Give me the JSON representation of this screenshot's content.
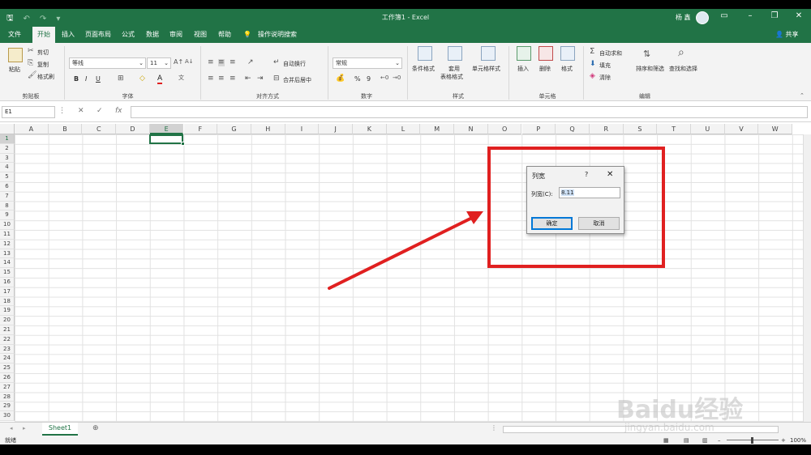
{
  "app": {
    "window_title": "工作簿1 - Excel",
    "user_name": "杨 鑫",
    "share_label": "共享"
  },
  "menu_tabs": [
    "文件",
    "开始",
    "插入",
    "页面布局",
    "公式",
    "数据",
    "审阅",
    "视图",
    "帮助"
  ],
  "active_tab": "开始",
  "tell_me": "操作说明搜索",
  "ribbon": {
    "clipboard": {
      "paste": "粘贴",
      "cut": "剪切",
      "copy": "复制",
      "format_painter": "格式刷",
      "group": "剪贴板"
    },
    "font": {
      "font_name": "等线",
      "font_size": "11",
      "bold": "B",
      "italic": "I",
      "underline": "U",
      "font_color": "A",
      "group": "字体"
    },
    "alignment": {
      "wrap_text": "自动换行",
      "merge_center": "合并后居中",
      "group": "对齐方式"
    },
    "number": {
      "format": "常规",
      "percent": "%",
      "comma": "9",
      "group": "数字"
    },
    "styles": {
      "conditional": "条件格式",
      "table_format_1": "套用",
      "table_format_2": "表格格式",
      "cell_styles": "单元格样式",
      "group": "样式"
    },
    "cells": {
      "insert": "插入",
      "delete": "删除",
      "format": "格式",
      "group": "单元格"
    },
    "editing": {
      "autosum": "自动求和",
      "fill": "填充",
      "clear": "清除",
      "sort_filter": "排序和筛选",
      "find_select": "查找和选择",
      "group": "编辑"
    }
  },
  "formula_bar": {
    "name_box": "E1",
    "cancel": "✕",
    "enter": "✓",
    "fx": "fx",
    "value": ""
  },
  "columns": [
    "A",
    "B",
    "C",
    "D",
    "E",
    "F",
    "G",
    "H",
    "I",
    "J",
    "K",
    "L",
    "M",
    "N",
    "O",
    "P",
    "Q",
    "R",
    "S",
    "T",
    "U",
    "V",
    "W"
  ],
  "selected_column": "E",
  "rows": [
    "1",
    "2",
    "3",
    "4",
    "5",
    "6",
    "7",
    "8",
    "9",
    "10",
    "11",
    "12",
    "13",
    "14",
    "15",
    "16",
    "17",
    "18",
    "19",
    "20",
    "21",
    "22",
    "23",
    "24",
    "25",
    "26",
    "27",
    "28",
    "29",
    "30"
  ],
  "selected_row": "1",
  "sheet_tabs": [
    "Sheet1"
  ],
  "status": {
    "ready": "就绪",
    "zoom": "100%"
  },
  "dialog": {
    "title": "列宽",
    "help": "?",
    "close": "✕",
    "label": "列宽(C):",
    "value": "8.11",
    "ok": "确定",
    "cancel": "取消"
  },
  "watermark": {
    "logo": "Baidu经验",
    "url": "jingyan.baidu.com"
  },
  "colors": {
    "excel_green": "#217346",
    "annotation_red": "#e02020",
    "dialog_accent": "#0078d7"
  }
}
